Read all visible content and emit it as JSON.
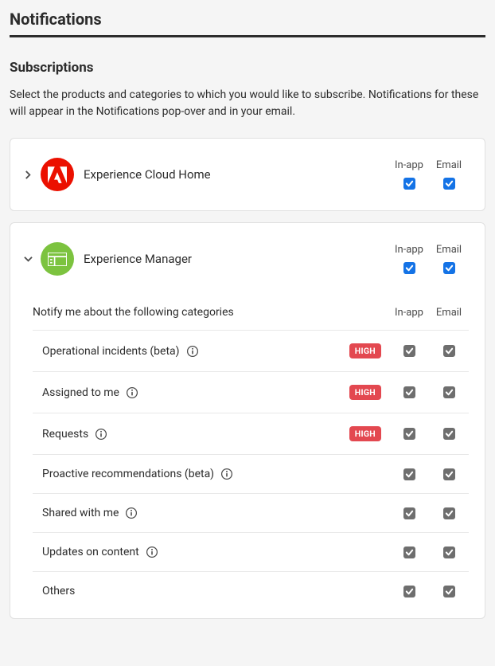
{
  "page": {
    "title": "Notifications",
    "section_title": "Subscriptions",
    "section_desc": "Select the products and categories to which you would like to subscribe. Notifications for these will appear in the Notifications pop-over and in your email."
  },
  "columns": {
    "inapp": "In-app",
    "email": "Email"
  },
  "products": [
    {
      "id": "ech",
      "name": "Experience Cloud Home",
      "expanded": false,
      "inapp_checked": true,
      "email_checked": true
    },
    {
      "id": "em",
      "name": "Experience Manager",
      "expanded": true,
      "inapp_checked": true,
      "email_checked": true,
      "categories_header": "Notify me about the following categories",
      "categories": [
        {
          "label": "Operational incidents (beta)",
          "info": true,
          "badge": "HIGH",
          "inapp": true,
          "email": true
        },
        {
          "label": "Assigned to me",
          "info": true,
          "badge": "HIGH",
          "inapp": true,
          "email": true
        },
        {
          "label": "Requests",
          "info": true,
          "badge": "HIGH",
          "inapp": true,
          "email": true
        },
        {
          "label": "Proactive recommendations (beta)",
          "info": true,
          "badge": null,
          "inapp": true,
          "email": true
        },
        {
          "label": "Shared with me",
          "info": true,
          "badge": null,
          "inapp": true,
          "email": true
        },
        {
          "label": "Updates on content",
          "info": true,
          "badge": null,
          "inapp": true,
          "email": true
        },
        {
          "label": "Others",
          "info": false,
          "badge": null,
          "inapp": true,
          "email": true
        }
      ]
    }
  ]
}
